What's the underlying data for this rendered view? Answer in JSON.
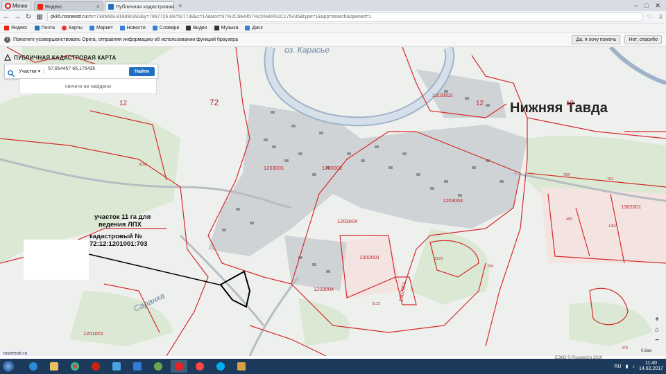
{
  "browser": {
    "menu_label": "Меню",
    "tabs": [
      {
        "label": "Яндекс",
        "favicon_color": "#e21"
      },
      {
        "label": "Публичная кадастровая к",
        "favicon_color": "#1f6fc4"
      }
    ],
    "new_tab": "+",
    "url_host": "pkk5.rosreestr.ru",
    "url_rest": "/#x=7365669.819890393&y=7897726.697507738&z=14&text=57%2C664457%20%66%2C175435&type=1&app=search&opened=1",
    "bookmarks": [
      {
        "label": "Яндекс",
        "color": "#e21"
      },
      {
        "label": "Почта",
        "color": "#2a6fbf"
      },
      {
        "label": "Карты",
        "color": "#e33"
      },
      {
        "label": "Маркет",
        "color": "#3a7fd0"
      },
      {
        "label": "Новости",
        "color": "#3a7fd0"
      },
      {
        "label": "Словари",
        "color": "#3a7fd0"
      },
      {
        "label": "Видео",
        "color": "#333"
      },
      {
        "label": "Музыка",
        "color": "#333"
      },
      {
        "label": "Диск",
        "color": "#3a7fd0"
      }
    ],
    "infobar_message": "Помогите усовершенствовать Opera, отправляя информацию об использовании функций браузера",
    "infobar_buttons": [
      "Да, я хочу помочь",
      "Нет, спасибо"
    ]
  },
  "panel": {
    "title": "ПУБЛИЧНАЯ КАДАСТРОВАЯ КАРТА",
    "scope": "Участки",
    "search_value": "57,664457 66,175435",
    "find_button": "Найти",
    "no_result": "Ничего не найдено"
  },
  "map_labels": {
    "town": "Нижняя Тавда",
    "lake": "оз. Карасье",
    "river": "Саранка",
    "quarter_72": "72",
    "quarter_12a": "12",
    "quarter_12b": "12",
    "quarter_12c": "12",
    "parcels": [
      "1203001",
      "1203002",
      "1203003",
      "1203004",
      "1203004",
      "1203004",
      "1302001",
      "1302001",
      "1201001",
      "1302001"
    ],
    "small": [
      "3160",
      "762",
      "761",
      "1367",
      "455",
      "3123",
      "708",
      "3123",
      "476"
    ]
  },
  "annotation": {
    "line1": "участок 11 га для",
    "line2": "ведения ЛПХ",
    "line3": "кадастровый №",
    "line4": "72:12:1201001:703"
  },
  "footer": {
    "status_url": "rosreestr.ru",
    "copyright": "ЕЭКО © Росреестр 2010",
    "scale": "0.6км"
  },
  "taskbar": {
    "lang": "RU",
    "time": "11:40",
    "date": "14.02.2017"
  },
  "colors": {
    "boundary": "#d42a2a",
    "river": "#8a9bb3",
    "forest": "#d7e6cf",
    "accent": "#1f6fc4"
  }
}
